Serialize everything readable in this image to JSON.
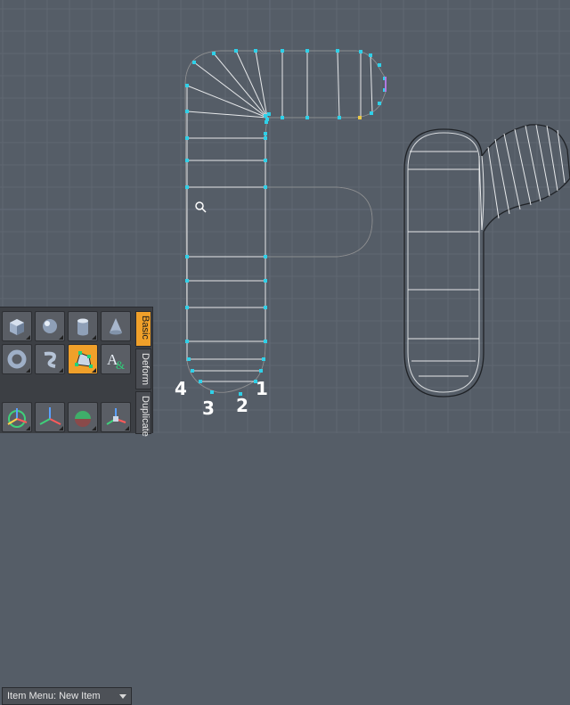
{
  "viewport": {
    "background": "#555d67",
    "grid_color": "#626a75",
    "wire_color": "#e6e8ea",
    "vertex_color": "#2fd0e8",
    "selected_vertex_color": "#e8c84a",
    "point_labels": [
      "1",
      "2",
      "3",
      "4"
    ]
  },
  "toolbox": {
    "tabs": [
      {
        "label": "Basic",
        "active": true
      },
      {
        "label": "Deform",
        "active": false
      },
      {
        "label": "Duplicate",
        "active": false
      }
    ],
    "tools_row1": [
      "cube-icon",
      "sphere-icon",
      "cylinder-icon",
      "cone-icon"
    ],
    "tools_row2": [
      "torus-icon",
      "tube-icon",
      "pen-icon",
      "text-icon"
    ],
    "tools_row3": [
      "move-icon",
      "rotate-icon",
      "scale-icon",
      "transform-icon"
    ],
    "text_tool_glyph": "A",
    "item_menu": "Item Menu: New Item"
  }
}
